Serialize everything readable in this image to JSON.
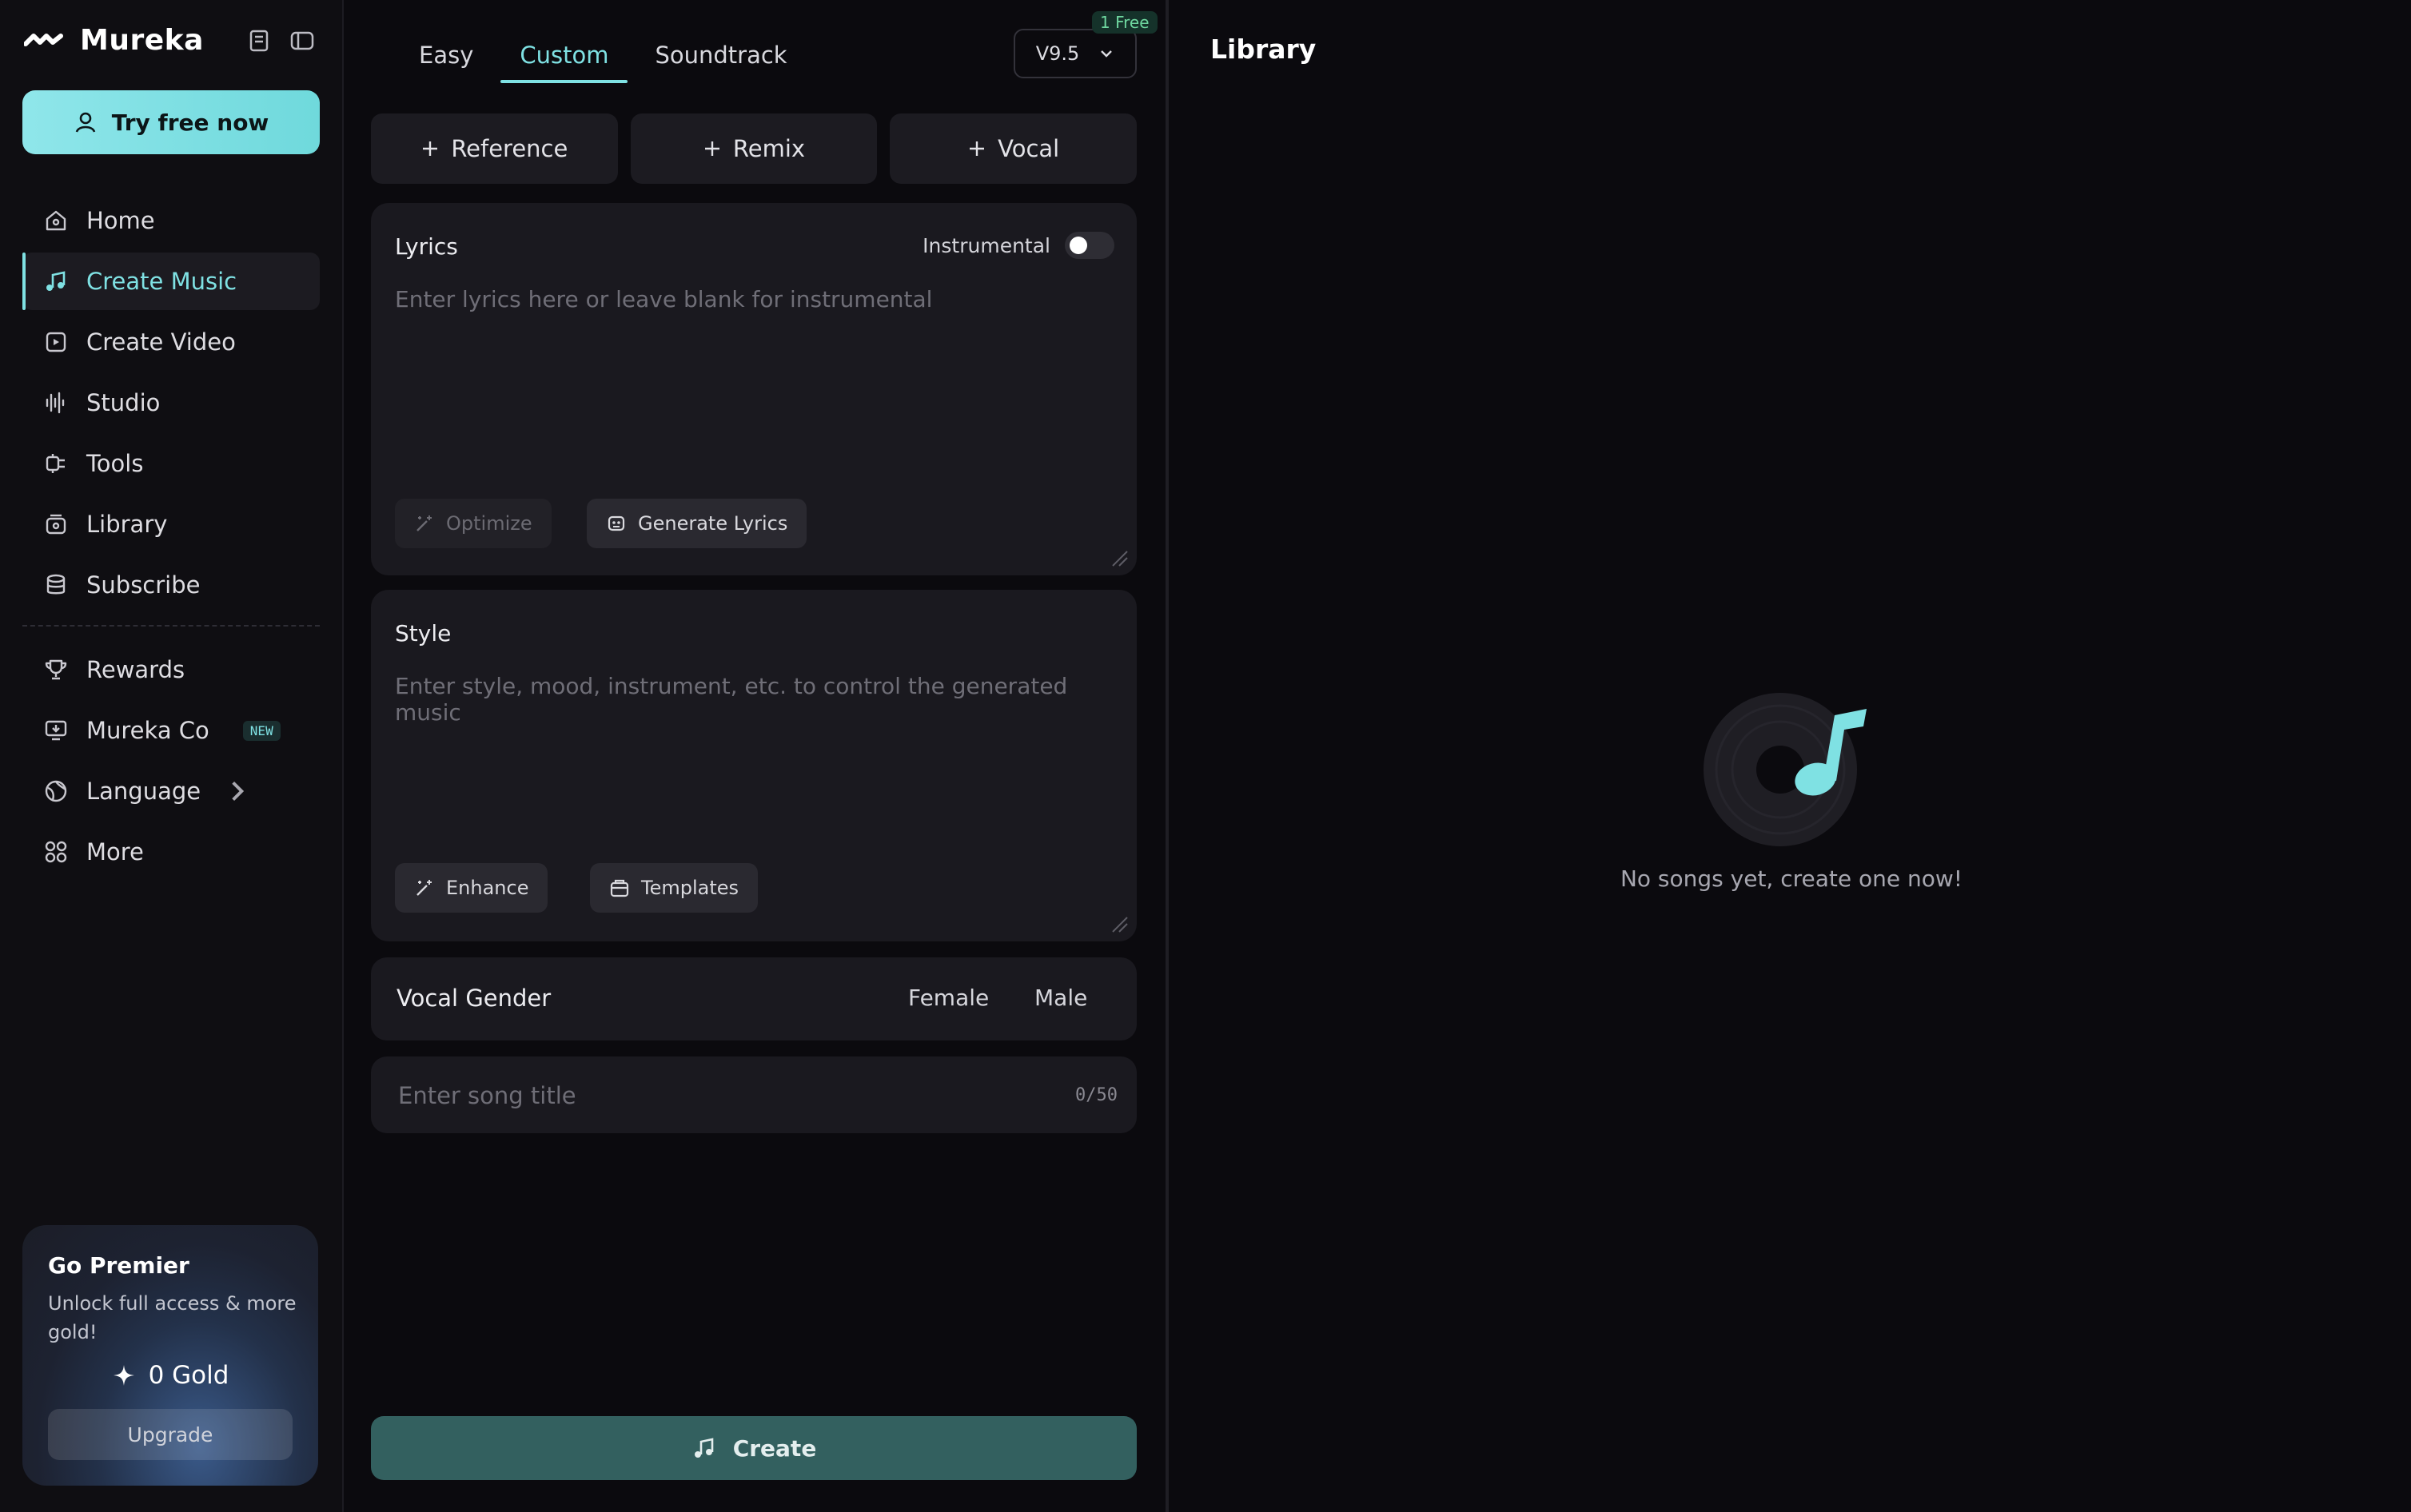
{
  "app": {
    "name": "Mureka"
  },
  "sidebar": {
    "try_free": "Try free now",
    "items": [
      {
        "label": "Home"
      },
      {
        "label": "Create Music"
      },
      {
        "label": "Create Video"
      },
      {
        "label": "Studio"
      },
      {
        "label": "Tools"
      },
      {
        "label": "Library"
      },
      {
        "label": "Subscribe"
      },
      {
        "label": "Rewards"
      },
      {
        "label": "Mureka Co",
        "badge": "NEW"
      },
      {
        "label": "Language"
      },
      {
        "label": "More"
      }
    ],
    "premier": {
      "title": "Go Premier",
      "subtitle": "Unlock full access & more gold!",
      "gold": "0 Gold",
      "upgrade": "Upgrade"
    }
  },
  "center": {
    "tabs": [
      {
        "label": "Easy"
      },
      {
        "label": "Custom"
      },
      {
        "label": "Soundtrack"
      }
    ],
    "version": "V9.5",
    "free_badge": "1 Free",
    "chips": [
      {
        "label": "Reference"
      },
      {
        "label": "Remix"
      },
      {
        "label": "Vocal"
      }
    ],
    "lyrics": {
      "title": "Lyrics",
      "instrumental": "Instrumental",
      "placeholder": "Enter lyrics here or leave blank for instrumental",
      "optimize": "Optimize",
      "generate": "Generate Lyrics"
    },
    "style": {
      "title": "Style",
      "placeholder": "Enter style, mood, instrument, etc. to control the generated music",
      "enhance": "Enhance",
      "templates": "Templates"
    },
    "vocal_gender": {
      "label": "Vocal Gender",
      "female": "Female",
      "male": "Male"
    },
    "song_title": {
      "placeholder": "Enter song title",
      "count": "0/50"
    },
    "create": "Create"
  },
  "library": {
    "title": "Library",
    "empty": "No songs yet, create one now!"
  },
  "colors": {
    "accent": "#7fe1e3",
    "create_btn": "#33605f",
    "panel": "#1a191f"
  }
}
